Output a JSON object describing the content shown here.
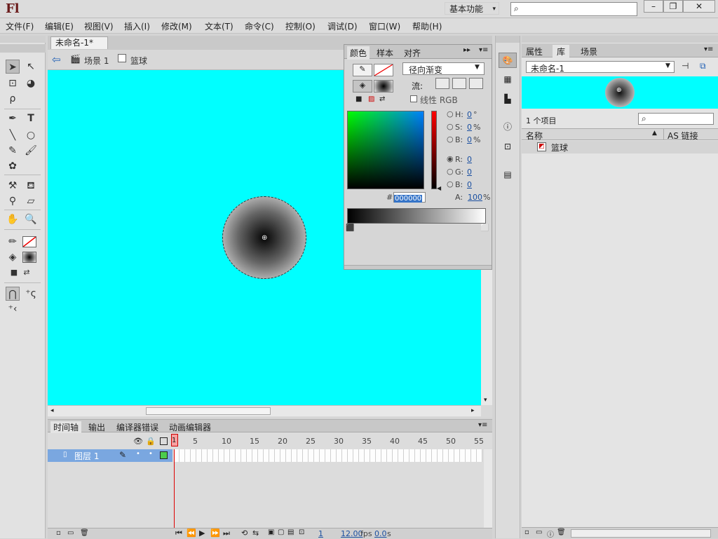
{
  "app": {
    "logo": "Fl",
    "workspace_label": "基本功能"
  },
  "menu": [
    "文件(F)",
    "编辑(E)",
    "视图(V)",
    "插入(I)",
    "修改(M)",
    "文本(T)",
    "命令(C)",
    "控制(O)",
    "调试(D)",
    "窗口(W)",
    "帮助(H)"
  ],
  "document": {
    "tab_title": "未命名-1*",
    "close": "×",
    "scene": "场景 1",
    "symbol": "篮球"
  },
  "colorPanel": {
    "tabs": [
      "颜色",
      "样本",
      "对齐"
    ],
    "type_value": "径向渐变",
    "flow_label": "流:",
    "linear_rgb_label": "线性 RGB",
    "hex_prefix": "#",
    "hex_value": "000000",
    "h_label": "H:",
    "h_value": "0",
    "h_unit": "°",
    "s_label": "S:",
    "s_value": "0",
    "s_unit": "%",
    "b_label": "B:",
    "b_value": "0",
    "b_unit": "%",
    "r_label": "R:",
    "r_value": "0",
    "g_label": "G:",
    "g_value": "0",
    "bb_label": "B:",
    "bb_value": "0",
    "a_label": "A:",
    "a_value": "100",
    "a_unit": "%"
  },
  "timeline": {
    "tabs": [
      "时间轴",
      "输出",
      "编译器错误",
      "动画编辑器"
    ],
    "frame_numbers": [
      "1",
      "5",
      "10",
      "15",
      "20",
      "25",
      "30",
      "35",
      "40",
      "45",
      "50",
      "55"
    ],
    "layer_name": "图层 1",
    "current_frame": "1",
    "fps": "12.00",
    "fps_unit": "fps",
    "time": "0.0",
    "time_unit": "s"
  },
  "library": {
    "tabs": [
      "属性",
      "库",
      "场景"
    ],
    "doc_select": "未命名-1",
    "item_count": "1 个项目",
    "col_name": "名称",
    "col_link": "AS 链接",
    "items": [
      {
        "name": "篮球"
      }
    ]
  },
  "colors": {
    "stage": "#00ffff",
    "accent_blue": "#7aa7e0"
  }
}
